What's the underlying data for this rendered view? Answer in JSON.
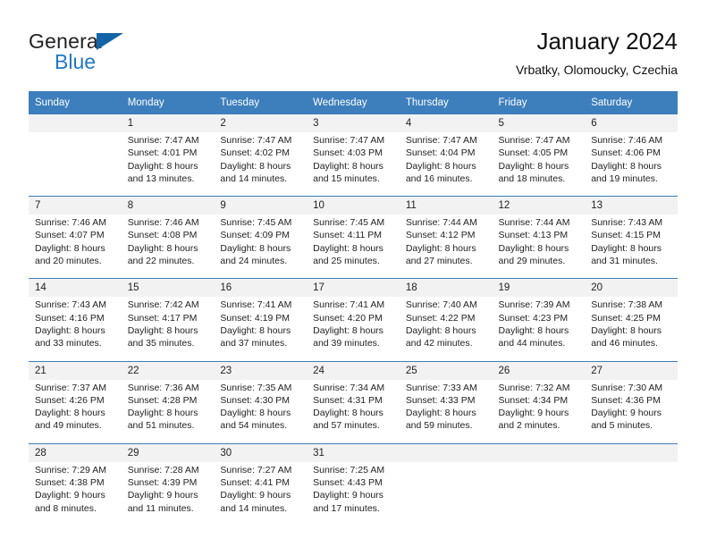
{
  "brand": {
    "name_part1": "General",
    "name_part2": "Blue",
    "triangle_color": "#1364a6",
    "blue_color": "#1f77c4"
  },
  "header": {
    "title": "January 2024",
    "subtitle": "Vrbatky, Olomoucky, Czechia"
  },
  "theme": {
    "header_blue": "#3d7ebc",
    "daynum_background": "#f2f2f2"
  },
  "weekday_headers": [
    "Sunday",
    "Monday",
    "Tuesday",
    "Wednesday",
    "Thursday",
    "Friday",
    "Saturday"
  ],
  "weeks": [
    {
      "days": [
        {
          "num": "",
          "lines": [
            "",
            "",
            "",
            ""
          ]
        },
        {
          "num": "1",
          "lines": [
            "Sunrise: 7:47 AM",
            "Sunset: 4:01 PM",
            "Daylight: 8 hours",
            "and 13 minutes."
          ]
        },
        {
          "num": "2",
          "lines": [
            "Sunrise: 7:47 AM",
            "Sunset: 4:02 PM",
            "Daylight: 8 hours",
            "and 14 minutes."
          ]
        },
        {
          "num": "3",
          "lines": [
            "Sunrise: 7:47 AM",
            "Sunset: 4:03 PM",
            "Daylight: 8 hours",
            "and 15 minutes."
          ]
        },
        {
          "num": "4",
          "lines": [
            "Sunrise: 7:47 AM",
            "Sunset: 4:04 PM",
            "Daylight: 8 hours",
            "and 16 minutes."
          ]
        },
        {
          "num": "5",
          "lines": [
            "Sunrise: 7:47 AM",
            "Sunset: 4:05 PM",
            "Daylight: 8 hours",
            "and 18 minutes."
          ]
        },
        {
          "num": "6",
          "lines": [
            "Sunrise: 7:46 AM",
            "Sunset: 4:06 PM",
            "Daylight: 8 hours",
            "and 19 minutes."
          ]
        }
      ]
    },
    {
      "days": [
        {
          "num": "7",
          "lines": [
            "Sunrise: 7:46 AM",
            "Sunset: 4:07 PM",
            "Daylight: 8 hours",
            "and 20 minutes."
          ]
        },
        {
          "num": "8",
          "lines": [
            "Sunrise: 7:46 AM",
            "Sunset: 4:08 PM",
            "Daylight: 8 hours",
            "and 22 minutes."
          ]
        },
        {
          "num": "9",
          "lines": [
            "Sunrise: 7:45 AM",
            "Sunset: 4:09 PM",
            "Daylight: 8 hours",
            "and 24 minutes."
          ]
        },
        {
          "num": "10",
          "lines": [
            "Sunrise: 7:45 AM",
            "Sunset: 4:11 PM",
            "Daylight: 8 hours",
            "and 25 minutes."
          ]
        },
        {
          "num": "11",
          "lines": [
            "Sunrise: 7:44 AM",
            "Sunset: 4:12 PM",
            "Daylight: 8 hours",
            "and 27 minutes."
          ]
        },
        {
          "num": "12",
          "lines": [
            "Sunrise: 7:44 AM",
            "Sunset: 4:13 PM",
            "Daylight: 8 hours",
            "and 29 minutes."
          ]
        },
        {
          "num": "13",
          "lines": [
            "Sunrise: 7:43 AM",
            "Sunset: 4:15 PM",
            "Daylight: 8 hours",
            "and 31 minutes."
          ]
        }
      ]
    },
    {
      "days": [
        {
          "num": "14",
          "lines": [
            "Sunrise: 7:43 AM",
            "Sunset: 4:16 PM",
            "Daylight: 8 hours",
            "and 33 minutes."
          ]
        },
        {
          "num": "15",
          "lines": [
            "Sunrise: 7:42 AM",
            "Sunset: 4:17 PM",
            "Daylight: 8 hours",
            "and 35 minutes."
          ]
        },
        {
          "num": "16",
          "lines": [
            "Sunrise: 7:41 AM",
            "Sunset: 4:19 PM",
            "Daylight: 8 hours",
            "and 37 minutes."
          ]
        },
        {
          "num": "17",
          "lines": [
            "Sunrise: 7:41 AM",
            "Sunset: 4:20 PM",
            "Daylight: 8 hours",
            "and 39 minutes."
          ]
        },
        {
          "num": "18",
          "lines": [
            "Sunrise: 7:40 AM",
            "Sunset: 4:22 PM",
            "Daylight: 8 hours",
            "and 42 minutes."
          ]
        },
        {
          "num": "19",
          "lines": [
            "Sunrise: 7:39 AM",
            "Sunset: 4:23 PM",
            "Daylight: 8 hours",
            "and 44 minutes."
          ]
        },
        {
          "num": "20",
          "lines": [
            "Sunrise: 7:38 AM",
            "Sunset: 4:25 PM",
            "Daylight: 8 hours",
            "and 46 minutes."
          ]
        }
      ]
    },
    {
      "days": [
        {
          "num": "21",
          "lines": [
            "Sunrise: 7:37 AM",
            "Sunset: 4:26 PM",
            "Daylight: 8 hours",
            "and 49 minutes."
          ]
        },
        {
          "num": "22",
          "lines": [
            "Sunrise: 7:36 AM",
            "Sunset: 4:28 PM",
            "Daylight: 8 hours",
            "and 51 minutes."
          ]
        },
        {
          "num": "23",
          "lines": [
            "Sunrise: 7:35 AM",
            "Sunset: 4:30 PM",
            "Daylight: 8 hours",
            "and 54 minutes."
          ]
        },
        {
          "num": "24",
          "lines": [
            "Sunrise: 7:34 AM",
            "Sunset: 4:31 PM",
            "Daylight: 8 hours",
            "and 57 minutes."
          ]
        },
        {
          "num": "25",
          "lines": [
            "Sunrise: 7:33 AM",
            "Sunset: 4:33 PM",
            "Daylight: 8 hours",
            "and 59 minutes."
          ]
        },
        {
          "num": "26",
          "lines": [
            "Sunrise: 7:32 AM",
            "Sunset: 4:34 PM",
            "Daylight: 9 hours",
            "and 2 minutes."
          ]
        },
        {
          "num": "27",
          "lines": [
            "Sunrise: 7:30 AM",
            "Sunset: 4:36 PM",
            "Daylight: 9 hours",
            "and 5 minutes."
          ]
        }
      ]
    },
    {
      "days": [
        {
          "num": "28",
          "lines": [
            "Sunrise: 7:29 AM",
            "Sunset: 4:38 PM",
            "Daylight: 9 hours",
            "and 8 minutes."
          ]
        },
        {
          "num": "29",
          "lines": [
            "Sunrise: 7:28 AM",
            "Sunset: 4:39 PM",
            "Daylight: 9 hours",
            "and 11 minutes."
          ]
        },
        {
          "num": "30",
          "lines": [
            "Sunrise: 7:27 AM",
            "Sunset: 4:41 PM",
            "Daylight: 9 hours",
            "and 14 minutes."
          ]
        },
        {
          "num": "31",
          "lines": [
            "Sunrise: 7:25 AM",
            "Sunset: 4:43 PM",
            "Daylight: 9 hours",
            "and 17 minutes."
          ]
        },
        {
          "num": "",
          "lines": [
            "",
            "",
            "",
            ""
          ]
        },
        {
          "num": "",
          "lines": [
            "",
            "",
            "",
            ""
          ]
        },
        {
          "num": "",
          "lines": [
            "",
            "",
            "",
            ""
          ]
        }
      ]
    }
  ]
}
